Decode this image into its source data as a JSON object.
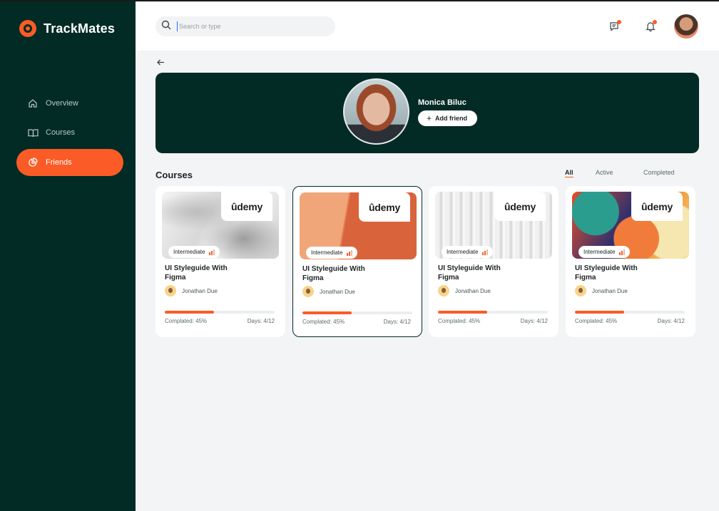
{
  "app": {
    "name": "TrackMates"
  },
  "sidebar": {
    "items": [
      {
        "label": "Overview",
        "icon": "home-icon",
        "active": false
      },
      {
        "label": "Courses",
        "icon": "book-icon",
        "active": false
      },
      {
        "label": "Friends",
        "icon": "pie-chart-icon",
        "active": true
      }
    ]
  },
  "topbar": {
    "search_placeholder": "Search or type",
    "icons": [
      "messages-icon",
      "bell-icon",
      "user-avatar"
    ]
  },
  "profile": {
    "name": "Monica Biluc",
    "add_friend_label": "Add friend"
  },
  "courses": {
    "title": "Courses",
    "filters": [
      {
        "label": "All",
        "active": true
      },
      {
        "label": "Active",
        "active": false
      },
      {
        "label": "Completed",
        "active": false
      }
    ],
    "cards": [
      {
        "provider": "ûdemy",
        "level": "Intermediate",
        "title": "UI Styleguide With Figma",
        "author": "Jonathan Due",
        "progress_percent": 45,
        "completed_text": "Complated: 45%",
        "days_text": "Days: 4/12",
        "selected": false
      },
      {
        "provider": "ûdemy",
        "level": "Intermediate",
        "title": "UI Styleguide With Figma",
        "author": "Jonathan Due",
        "progress_percent": 45,
        "completed_text": "Complated: 45%",
        "days_text": "Days: 4/12",
        "selected": true
      },
      {
        "provider": "ûdemy",
        "level": "Intermediate",
        "title": "UI Styleguide With Figma",
        "author": "Jonathan Due",
        "progress_percent": 45,
        "completed_text": "Complated: 45%",
        "days_text": "Days: 4/12",
        "selected": false
      },
      {
        "provider": "ûdemy",
        "level": "Intermediate",
        "title": "UI Styleguide With Figma",
        "author": "Jonathan Due",
        "progress_percent": 45,
        "completed_text": "Complated: 45%",
        "days_text": "Days: 4/12",
        "selected": false
      }
    ]
  },
  "colors": {
    "primary_dark": "#022b25",
    "accent": "#fb5b26",
    "background": "#f2f4f5"
  }
}
